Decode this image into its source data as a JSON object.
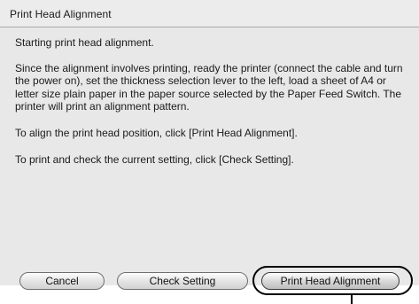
{
  "dialog": {
    "title": "Print Head Alignment"
  },
  "content": {
    "paragraphs": [
      "Starting print head alignment.",
      "Since the alignment involves printing, ready the printer (connect the cable and turn the power on), set the thickness selection lever to the left, load a sheet of A4 or letter size plain paper in the paper source selected by the Paper Feed Switch. The printer will print an alignment pattern.",
      "To align the print head position, click [Print Head Alignment].",
      "To print and check the current setting, click [Check Setting]."
    ]
  },
  "buttons": {
    "cancel": "Cancel",
    "check_setting": "Check Setting",
    "print_head_alignment": "Print Head Alignment"
  },
  "colors": {
    "dialog_bg": "#e8e8e8",
    "callout": "#000000"
  }
}
